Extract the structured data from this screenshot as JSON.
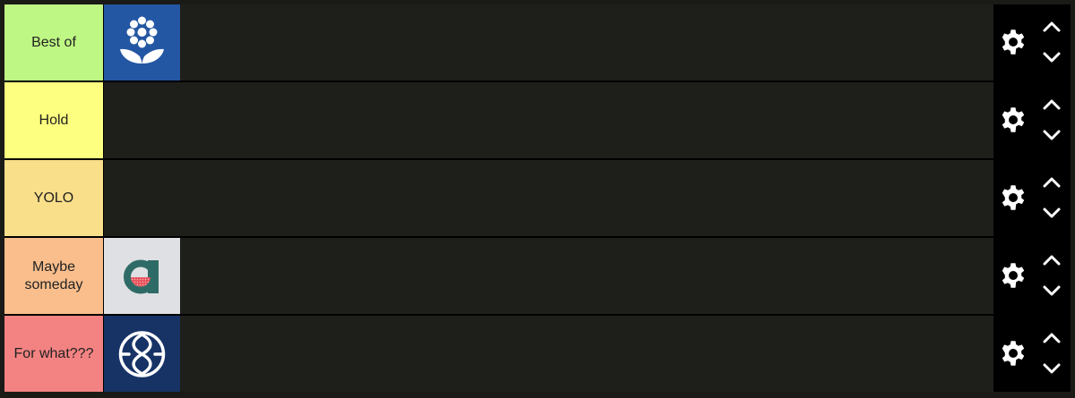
{
  "tiers": [
    {
      "label": "Best of",
      "color": "#bff784",
      "items": [
        "flower-logo"
      ]
    },
    {
      "label": "Hold",
      "color": "#fcff7f",
      "items": []
    },
    {
      "label": "YOLO",
      "color": "#fadf8a",
      "items": []
    },
    {
      "label": "Maybe someday",
      "color": "#f9be8c",
      "items": [
        "letter-a-logo"
      ]
    },
    {
      "label": "For what???",
      "color": "#f38382",
      "items": [
        "circle-swirl-logo"
      ]
    }
  ],
  "icons": {
    "settings": "gear-icon",
    "move_up": "chevron-up-icon",
    "move_down": "chevron-down-icon"
  }
}
